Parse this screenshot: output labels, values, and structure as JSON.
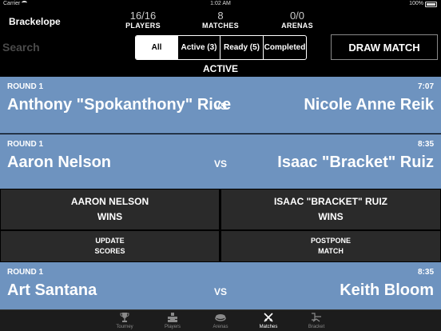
{
  "status_bar": {
    "carrier": "Carrier",
    "time": "1:02 AM",
    "battery": "100%"
  },
  "header": {
    "app_title": "Brackelope",
    "stats": {
      "players": {
        "value": "16/16",
        "label": "PLAYERS"
      },
      "matches": {
        "value": "8",
        "label": "MATCHES"
      },
      "arenas": {
        "value": "0/0",
        "label": "ARENAS"
      }
    }
  },
  "search": {
    "placeholder": "Search",
    "value": ""
  },
  "filters": [
    {
      "label": "All",
      "selected": true
    },
    {
      "label": "Active (3)",
      "selected": false
    },
    {
      "label": "Ready (5)",
      "selected": false
    },
    {
      "label": "Completed",
      "selected": false
    }
  ],
  "draw_button": "DRAW MATCH",
  "section_label": "ACTIVE",
  "matches": [
    {
      "round": "ROUND 1",
      "time": "7:07",
      "player1": "Anthony \"Spokanthony\" Rice",
      "vs": "VS",
      "player2": "Nicole Anne Reik"
    },
    {
      "round": "ROUND 1",
      "time": "8:35",
      "player1": "Aaron Nelson",
      "vs": "VS",
      "player2": "Isaac \"Bracket\" Ruiz"
    },
    {
      "round": "ROUND 1",
      "time": "8:35",
      "player1": "Art Santana",
      "vs": "VS",
      "player2": "Keith Bloom"
    }
  ],
  "match_actions": {
    "win_left": {
      "line1": "AARON NELSON",
      "line2": "WINS"
    },
    "win_right": {
      "line1": "ISAAC \"BRACKET\" RUIZ",
      "line2": "WINS"
    },
    "update": {
      "line1": "UPDATE",
      "line2": "SCORES"
    },
    "postpone": {
      "line1": "POSTPONE",
      "line2": "MATCH"
    }
  },
  "colors": {
    "card_background": "#6e93bf",
    "action_background": "#2a2a2a",
    "app_background": "#000000"
  },
  "tabs": [
    {
      "label": "Tourney",
      "icon": "trophy-icon",
      "selected": false
    },
    {
      "label": "Players",
      "icon": "players-icon",
      "selected": false
    },
    {
      "label": "Arenas",
      "icon": "arena-icon",
      "selected": false
    },
    {
      "label": "Matches",
      "icon": "crossed-swords-icon",
      "selected": true
    },
    {
      "label": "Bracket",
      "icon": "bracket-icon",
      "selected": false
    }
  ]
}
